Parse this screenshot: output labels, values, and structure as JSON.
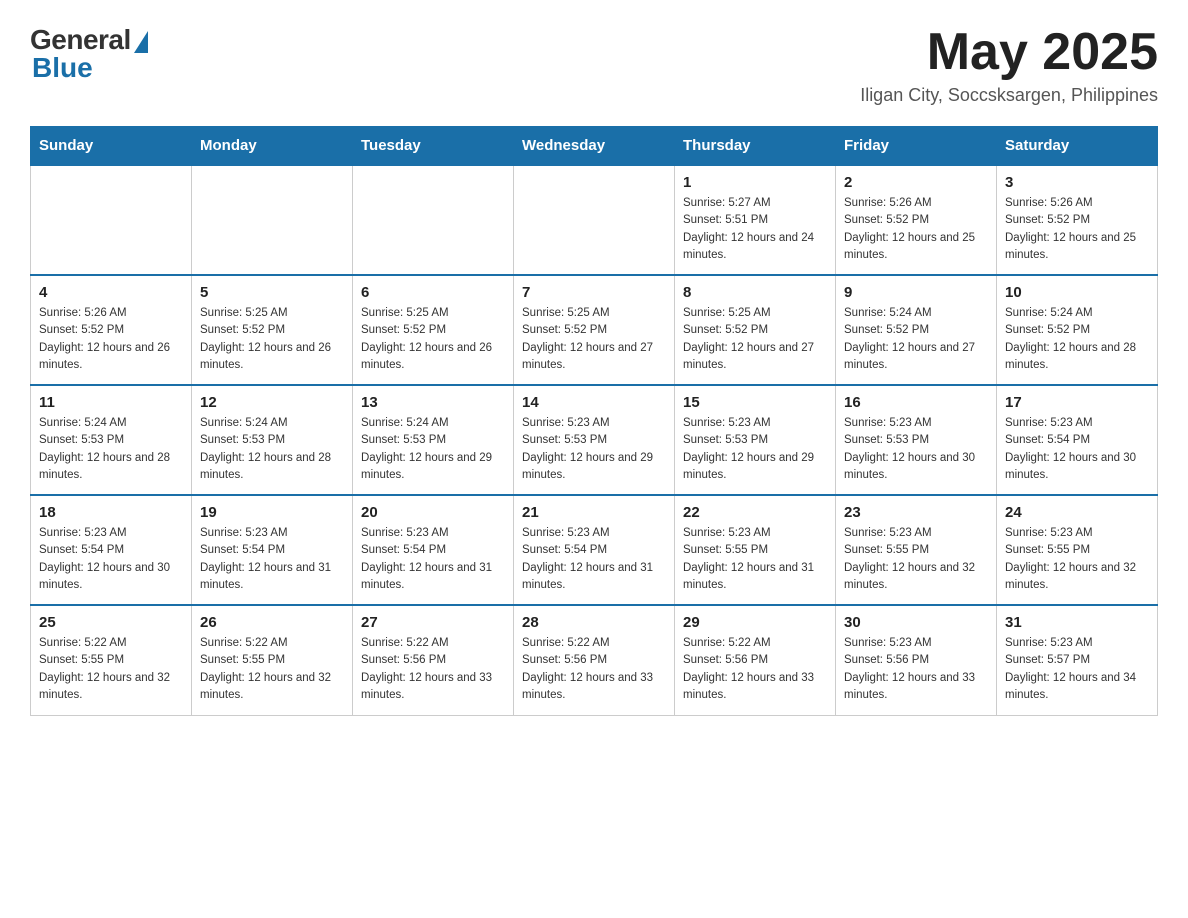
{
  "header": {
    "logo": {
      "general": "General",
      "blue": "Blue"
    },
    "title": "May 2025",
    "location": "Iligan City, Soccsksargen, Philippines"
  },
  "calendar": {
    "days_of_week": [
      "Sunday",
      "Monday",
      "Tuesday",
      "Wednesday",
      "Thursday",
      "Friday",
      "Saturday"
    ],
    "weeks": [
      [
        {
          "day": "",
          "sunrise": "",
          "sunset": "",
          "daylight": ""
        },
        {
          "day": "",
          "sunrise": "",
          "sunset": "",
          "daylight": ""
        },
        {
          "day": "",
          "sunrise": "",
          "sunset": "",
          "daylight": ""
        },
        {
          "day": "",
          "sunrise": "",
          "sunset": "",
          "daylight": ""
        },
        {
          "day": "1",
          "sunrise": "Sunrise: 5:27 AM",
          "sunset": "Sunset: 5:51 PM",
          "daylight": "Daylight: 12 hours and 24 minutes."
        },
        {
          "day": "2",
          "sunrise": "Sunrise: 5:26 AM",
          "sunset": "Sunset: 5:52 PM",
          "daylight": "Daylight: 12 hours and 25 minutes."
        },
        {
          "day": "3",
          "sunrise": "Sunrise: 5:26 AM",
          "sunset": "Sunset: 5:52 PM",
          "daylight": "Daylight: 12 hours and 25 minutes."
        }
      ],
      [
        {
          "day": "4",
          "sunrise": "Sunrise: 5:26 AM",
          "sunset": "Sunset: 5:52 PM",
          "daylight": "Daylight: 12 hours and 26 minutes."
        },
        {
          "day": "5",
          "sunrise": "Sunrise: 5:25 AM",
          "sunset": "Sunset: 5:52 PM",
          "daylight": "Daylight: 12 hours and 26 minutes."
        },
        {
          "day": "6",
          "sunrise": "Sunrise: 5:25 AM",
          "sunset": "Sunset: 5:52 PM",
          "daylight": "Daylight: 12 hours and 26 minutes."
        },
        {
          "day": "7",
          "sunrise": "Sunrise: 5:25 AM",
          "sunset": "Sunset: 5:52 PM",
          "daylight": "Daylight: 12 hours and 27 minutes."
        },
        {
          "day": "8",
          "sunrise": "Sunrise: 5:25 AM",
          "sunset": "Sunset: 5:52 PM",
          "daylight": "Daylight: 12 hours and 27 minutes."
        },
        {
          "day": "9",
          "sunrise": "Sunrise: 5:24 AM",
          "sunset": "Sunset: 5:52 PM",
          "daylight": "Daylight: 12 hours and 27 minutes."
        },
        {
          "day": "10",
          "sunrise": "Sunrise: 5:24 AM",
          "sunset": "Sunset: 5:52 PM",
          "daylight": "Daylight: 12 hours and 28 minutes."
        }
      ],
      [
        {
          "day": "11",
          "sunrise": "Sunrise: 5:24 AM",
          "sunset": "Sunset: 5:53 PM",
          "daylight": "Daylight: 12 hours and 28 minutes."
        },
        {
          "day": "12",
          "sunrise": "Sunrise: 5:24 AM",
          "sunset": "Sunset: 5:53 PM",
          "daylight": "Daylight: 12 hours and 28 minutes."
        },
        {
          "day": "13",
          "sunrise": "Sunrise: 5:24 AM",
          "sunset": "Sunset: 5:53 PM",
          "daylight": "Daylight: 12 hours and 29 minutes."
        },
        {
          "day": "14",
          "sunrise": "Sunrise: 5:23 AM",
          "sunset": "Sunset: 5:53 PM",
          "daylight": "Daylight: 12 hours and 29 minutes."
        },
        {
          "day": "15",
          "sunrise": "Sunrise: 5:23 AM",
          "sunset": "Sunset: 5:53 PM",
          "daylight": "Daylight: 12 hours and 29 minutes."
        },
        {
          "day": "16",
          "sunrise": "Sunrise: 5:23 AM",
          "sunset": "Sunset: 5:53 PM",
          "daylight": "Daylight: 12 hours and 30 minutes."
        },
        {
          "day": "17",
          "sunrise": "Sunrise: 5:23 AM",
          "sunset": "Sunset: 5:54 PM",
          "daylight": "Daylight: 12 hours and 30 minutes."
        }
      ],
      [
        {
          "day": "18",
          "sunrise": "Sunrise: 5:23 AM",
          "sunset": "Sunset: 5:54 PM",
          "daylight": "Daylight: 12 hours and 30 minutes."
        },
        {
          "day": "19",
          "sunrise": "Sunrise: 5:23 AM",
          "sunset": "Sunset: 5:54 PM",
          "daylight": "Daylight: 12 hours and 31 minutes."
        },
        {
          "day": "20",
          "sunrise": "Sunrise: 5:23 AM",
          "sunset": "Sunset: 5:54 PM",
          "daylight": "Daylight: 12 hours and 31 minutes."
        },
        {
          "day": "21",
          "sunrise": "Sunrise: 5:23 AM",
          "sunset": "Sunset: 5:54 PM",
          "daylight": "Daylight: 12 hours and 31 minutes."
        },
        {
          "day": "22",
          "sunrise": "Sunrise: 5:23 AM",
          "sunset": "Sunset: 5:55 PM",
          "daylight": "Daylight: 12 hours and 31 minutes."
        },
        {
          "day": "23",
          "sunrise": "Sunrise: 5:23 AM",
          "sunset": "Sunset: 5:55 PM",
          "daylight": "Daylight: 12 hours and 32 minutes."
        },
        {
          "day": "24",
          "sunrise": "Sunrise: 5:23 AM",
          "sunset": "Sunset: 5:55 PM",
          "daylight": "Daylight: 12 hours and 32 minutes."
        }
      ],
      [
        {
          "day": "25",
          "sunrise": "Sunrise: 5:22 AM",
          "sunset": "Sunset: 5:55 PM",
          "daylight": "Daylight: 12 hours and 32 minutes."
        },
        {
          "day": "26",
          "sunrise": "Sunrise: 5:22 AM",
          "sunset": "Sunset: 5:55 PM",
          "daylight": "Daylight: 12 hours and 32 minutes."
        },
        {
          "day": "27",
          "sunrise": "Sunrise: 5:22 AM",
          "sunset": "Sunset: 5:56 PM",
          "daylight": "Daylight: 12 hours and 33 minutes."
        },
        {
          "day": "28",
          "sunrise": "Sunrise: 5:22 AM",
          "sunset": "Sunset: 5:56 PM",
          "daylight": "Daylight: 12 hours and 33 minutes."
        },
        {
          "day": "29",
          "sunrise": "Sunrise: 5:22 AM",
          "sunset": "Sunset: 5:56 PM",
          "daylight": "Daylight: 12 hours and 33 minutes."
        },
        {
          "day": "30",
          "sunrise": "Sunrise: 5:23 AM",
          "sunset": "Sunset: 5:56 PM",
          "daylight": "Daylight: 12 hours and 33 minutes."
        },
        {
          "day": "31",
          "sunrise": "Sunrise: 5:23 AM",
          "sunset": "Sunset: 5:57 PM",
          "daylight": "Daylight: 12 hours and 34 minutes."
        }
      ]
    ]
  }
}
